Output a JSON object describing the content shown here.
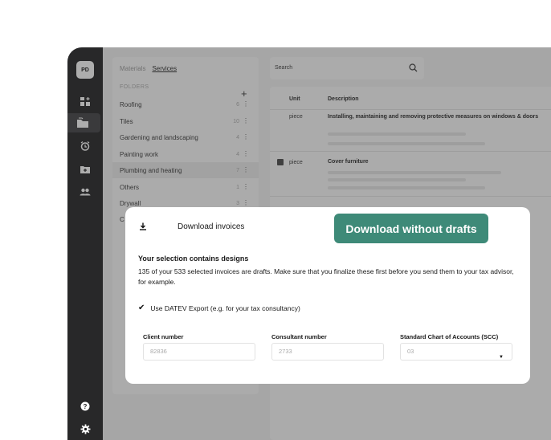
{
  "app": {
    "logo_text": "PD"
  },
  "sidebar": {
    "items": [
      {
        "icon": "dashboard-icon"
      },
      {
        "icon": "folder-icon",
        "active": true
      },
      {
        "icon": "alarm-clock-icon"
      },
      {
        "icon": "folder-plus-icon"
      },
      {
        "icon": "users-icon"
      }
    ],
    "bottom": [
      {
        "icon": "help-icon"
      },
      {
        "icon": "settings-icon"
      }
    ]
  },
  "folders": {
    "tabs": [
      "Materials",
      "Services"
    ],
    "active_tab": "Services",
    "heading": "FOLDERS",
    "add_label": "+",
    "items": [
      {
        "name": "Roofing",
        "count": "6"
      },
      {
        "name": "Tiles",
        "count": "10"
      },
      {
        "name": "Gardening and landscaping",
        "count": "4"
      },
      {
        "name": "Painting work",
        "count": "4"
      },
      {
        "name": "Plumbing and heating",
        "count": "7",
        "highlight": true
      },
      {
        "name": "Others",
        "count": "1"
      },
      {
        "name": "Drywall",
        "count": "3"
      },
      {
        "name": "C",
        "count": ""
      }
    ]
  },
  "search": {
    "placeholder": "Search"
  },
  "table": {
    "headers": {
      "unit": "Unit",
      "description": "Description"
    },
    "rows": [
      {
        "unit": "piece",
        "description": "Installing, maintaining and removing protective measures on windows & doors",
        "checked": false
      },
      {
        "unit": "piece",
        "description": "Cover furniture",
        "checked": true
      }
    ]
  },
  "modal": {
    "title": "Download invoices",
    "primary_button": "Download without drafts",
    "warning_title": "Your selection contains designs",
    "warning_body": "135 of your 533 selected invoices are drafts. Make sure that you finalize these first before you send them to your tax advisor, for example.",
    "datev_label": "Use DATEV Export (e.g. for your tax consultancy)",
    "datev_checked": true,
    "fields": {
      "client_number": {
        "label": "Client number",
        "value": "82836"
      },
      "consultant_number": {
        "label": "Consultant number",
        "value": "2733"
      },
      "scc": {
        "label": "Standard Chart of Accounts (SCC)",
        "value": "03"
      }
    }
  }
}
